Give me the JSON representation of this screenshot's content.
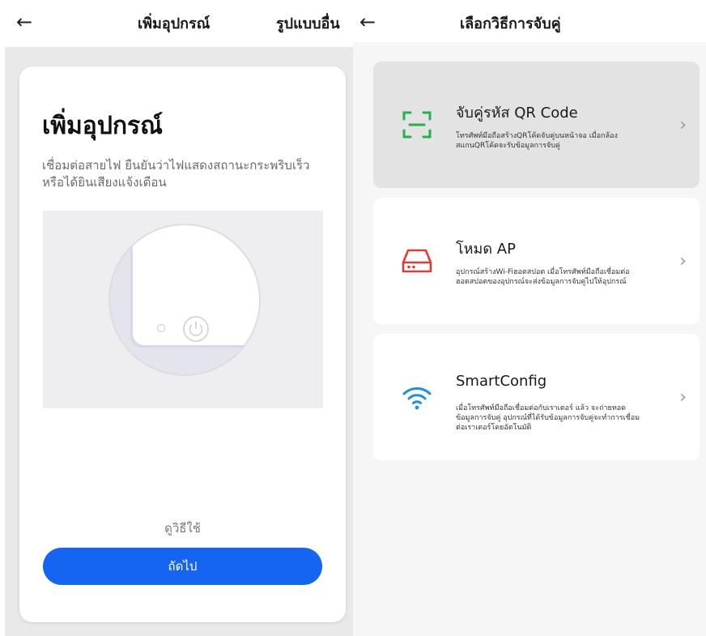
{
  "left_screen": {
    "header": {
      "back_icon": "arrow-left-icon",
      "title": "เพิ่มอุปกรณ์",
      "alt_mode_label": "รูปแบบอื่น"
    },
    "card": {
      "title": "เพิ่มอุปกรณ์",
      "description": "เชื่อมต่อสายไฟ ยืนยันว่าไฟแสดงสถานะกระพริบเร็วหรือได้ยินเสียงแจ้งเตือน",
      "illustration_icon": "power-icon",
      "howto_label": "ดูวิธีใช้",
      "next_label": "ถัดไป"
    }
  },
  "right_screen": {
    "header": {
      "back_icon": "arrow-left-icon",
      "title": "เลือกวิธีการจับคู่"
    },
    "options": [
      {
        "icon": "qr-scan-icon",
        "title": "จับคู่รหัส QR Code",
        "description": "โทรศัพท์มือถือสร้างQRโค้ดจับคู่บนหน้าจอ เมื่อกล้องสแกนQRโค้ดจะรับข้อมูลการจับคู่",
        "selected": true
      },
      {
        "icon": "router-icon",
        "title": "โหมด AP",
        "description": "อุปกรณ์สร้างWi-Fiฮอตสปอต เมื่อโทรศัพท์มือถือเชื่อมต่อฮอตสปอตของอุปกรณ์จะส่งข้อมูลการจับคู่ไปให้อุปกรณ์",
        "selected": false
      },
      {
        "icon": "wifi-icon",
        "title": "SmartConfig",
        "description": "เมื่อโทรศัพท์มือถือเชื่อมต่อกับเราเตอร์ แล้ว จะถ่ายทอดข้อมูลการจับคู่ อุปกรณ์ที่ได้รับข้อมูลการจับคู่จะทำการเชื่อมต่อเราเตอร์โดยอัตโนมัติ",
        "selected": false
      }
    ],
    "chevron_icon": "chevron-right-icon"
  },
  "colors": {
    "primary_blue": "#1565f2",
    "qr_green": "#22b34a",
    "ap_red": "#e53935",
    "wifi_blue": "#1f8fe0",
    "selected_card": "#e3e3e3"
  }
}
